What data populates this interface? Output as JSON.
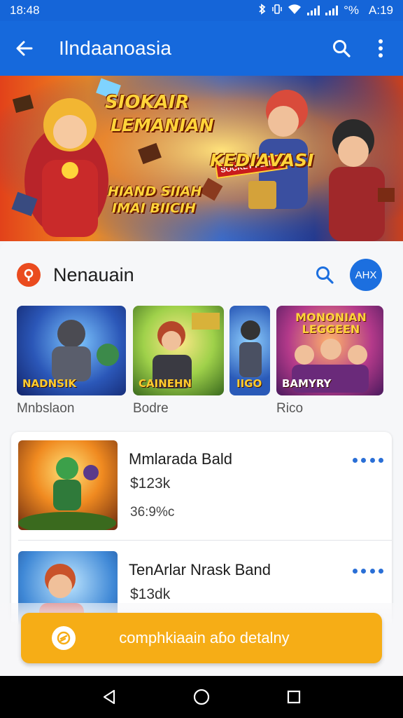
{
  "status": {
    "time_left": "18:48",
    "battery": "°%",
    "time_right": "A:19"
  },
  "appbar": {
    "title": "Ilndaanoasia"
  },
  "banner": {
    "line1": "SIOKAIR",
    "line2": "LEMANIAN",
    "sticker": "SOCKET LEMAN",
    "center": "KEDIAVASI",
    "bottom1": "HIAND SIIAH",
    "bottom2": "IMAI BIICIH"
  },
  "section": {
    "title": "Nenauain",
    "avatar": "AHX"
  },
  "tiles": [
    {
      "label": "NADNSIK",
      "caption": "Mnbslaon"
    },
    {
      "label": "CAINEHN",
      "caption": "Bodre"
    },
    {
      "label": "IIGO",
      "caption": ""
    },
    {
      "label": "BAMYRY",
      "caption": "Rico",
      "overlay": "MONONIAN LEGGEEN"
    }
  ],
  "list": [
    {
      "name": "Mmlarada Bald",
      "price": "$123k",
      "pct": "36:9%c"
    },
    {
      "name": "TenArlar Nrask Band",
      "price": "$13dk",
      "pct": ""
    }
  ],
  "cta": {
    "label": "comphkiaain aɓo detalny"
  },
  "colors": {
    "primary": "#1669dc",
    "accent": "#f6ad16",
    "pin": "#ea4b1f"
  }
}
